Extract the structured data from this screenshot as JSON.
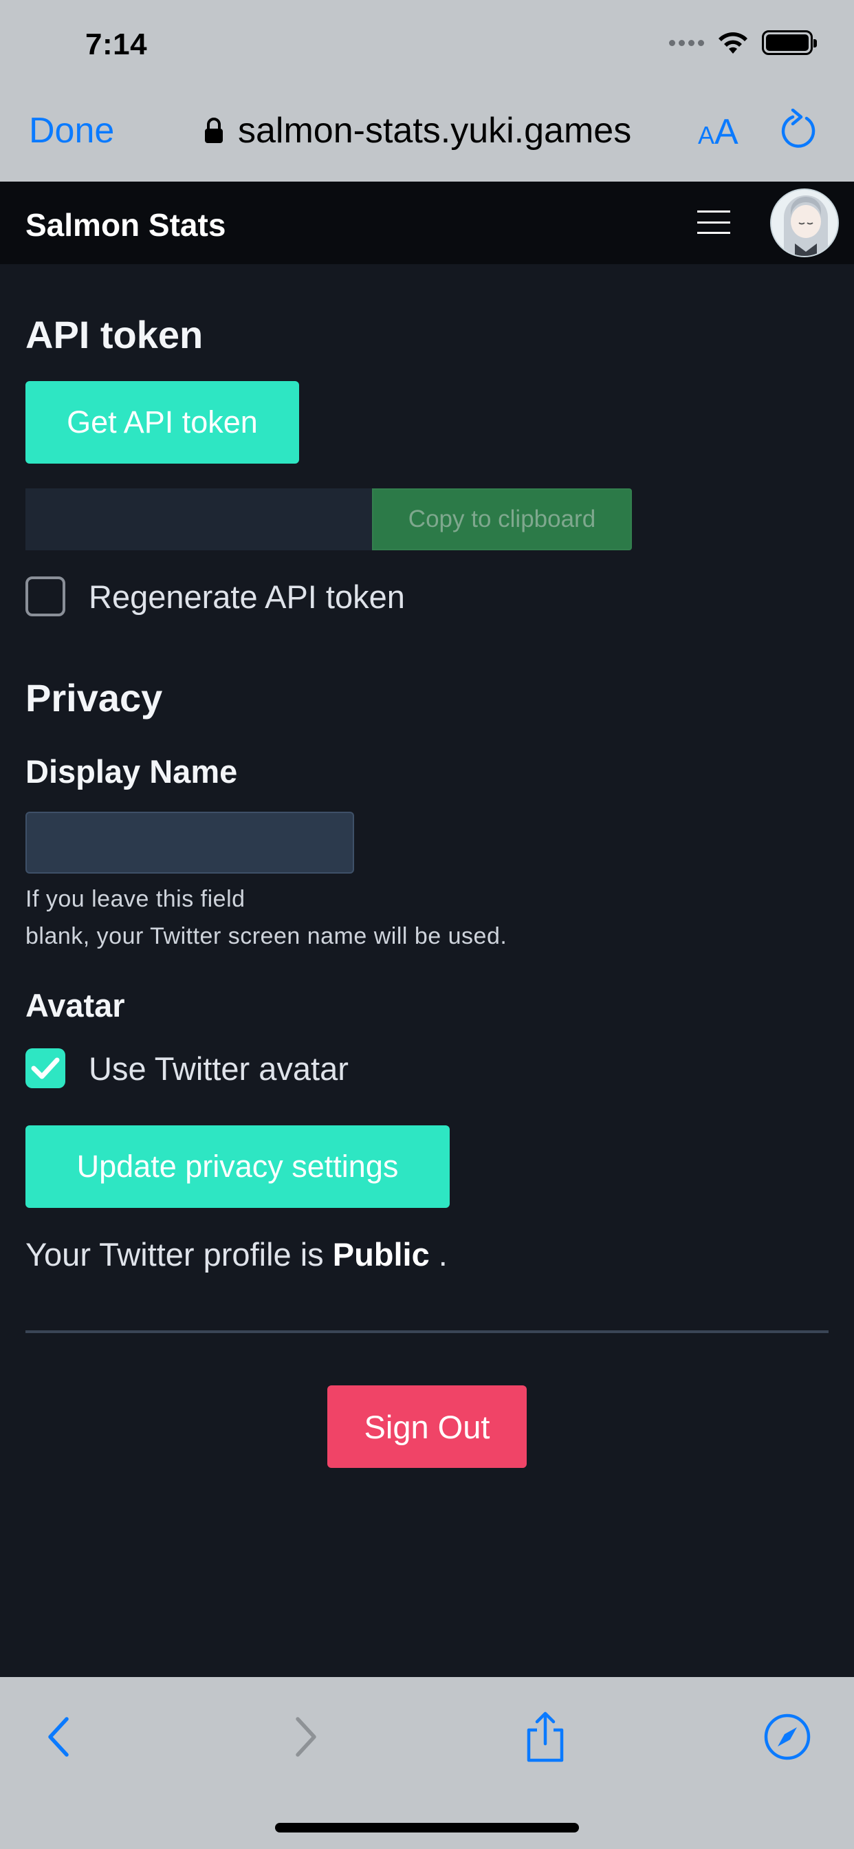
{
  "status_bar": {
    "time": "7:14"
  },
  "browser": {
    "done_label": "Done",
    "url": "salmon-stats.yuki.games",
    "aa_small": "A",
    "aa_large": "A"
  },
  "navbar": {
    "brand": "Salmon Stats"
  },
  "api_token": {
    "heading": "API token",
    "get_button": "Get API token",
    "token_value": "",
    "copy_button": "Copy to clipboard",
    "regenerate_label": "Regenerate API token",
    "regenerate_checked": false
  },
  "privacy": {
    "heading": "Privacy",
    "display_name_label": "Display Name",
    "display_name_value": "",
    "help_line1": "If you leave this field",
    "help_line2": "blank, your Twitter screen name will be used.",
    "avatar_label": "Avatar",
    "use_twitter_avatar_label": "Use Twitter avatar",
    "use_twitter_avatar_checked": true,
    "update_button": "Update privacy settings",
    "profile_prefix": "Your Twitter profile is",
    "profile_status": "Public",
    "profile_suffix": " ."
  },
  "sign_out_label": "Sign Out",
  "colors": {
    "accent": "#2ee6c3",
    "danger": "#f04467",
    "ios_blue": "#0a7aff",
    "background": "#141820"
  },
  "icons": [
    "lock-icon",
    "wifi-icon",
    "battery-icon",
    "reload-icon",
    "hamburger-icon",
    "back-icon",
    "forward-icon",
    "share-icon",
    "compass-icon",
    "checkmark-icon"
  ]
}
